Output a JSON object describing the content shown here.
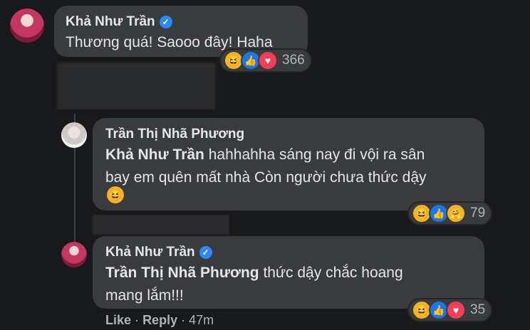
{
  "comments": [
    {
      "author": "Khả Như Trần",
      "verified": true,
      "text": "Thương quá! Saooo đây! Haha",
      "reactions": [
        "haha",
        "like",
        "love"
      ],
      "reaction_count": "366"
    },
    {
      "author": "Trần Thị Nhã Phương",
      "verified": false,
      "mention": "Khả Như Trần",
      "text_line1": " hahhahha sáng nay đi vội ra sân",
      "text_line2": "bay em quên mất nhà Còn người chưa thức dậy",
      "reactions": [
        "haha",
        "like",
        "care"
      ],
      "reaction_count": "79"
    },
    {
      "author": "Khả Như Trần",
      "verified": true,
      "mention": "Trần Thị Nhã Phương",
      "text_line1": " thức dậy chắc hoang",
      "text_line2": "mang lắm!!!",
      "reactions": [
        "haha",
        "like",
        "love"
      ],
      "reaction_count": "35",
      "actions": {
        "like": "Like",
        "reply": "Reply",
        "time": "47m",
        "sep": "·"
      }
    }
  ],
  "icons": {
    "verified": "✓",
    "haha": "😆",
    "like": "👍",
    "love": "♥",
    "care": "🤗"
  },
  "colors": {
    "background": "#18191a",
    "bubble": "#3a3b3c",
    "verified": "#2d88ff"
  }
}
